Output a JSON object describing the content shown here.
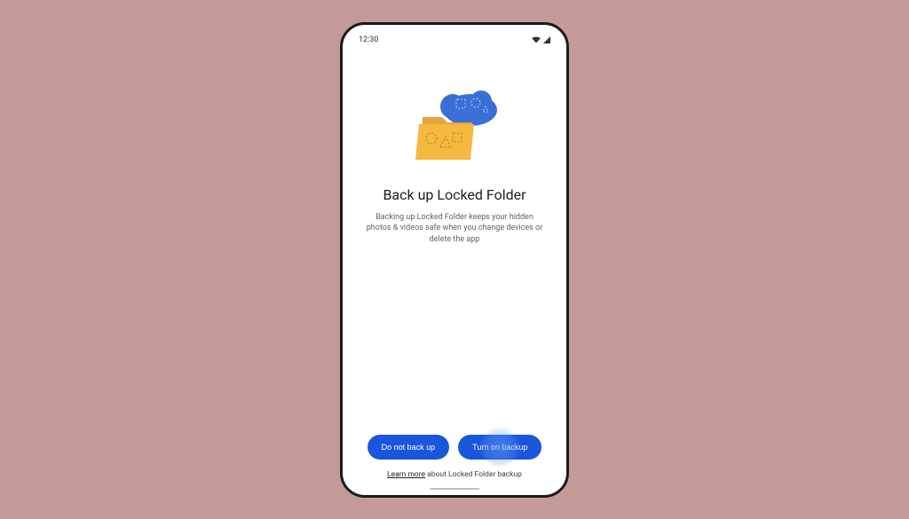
{
  "statusBar": {
    "time": "12:30"
  },
  "screen": {
    "title": "Back up Locked Folder",
    "subtitle": "Backing up Locked Folder keeps your hidden photos & videos safe when you change devices or delete the app"
  },
  "buttons": {
    "secondary": "Do not back up",
    "primary": "Turn on backup"
  },
  "footer": {
    "linkText": "Learn more",
    "rest": " about Locked Folder backup"
  }
}
